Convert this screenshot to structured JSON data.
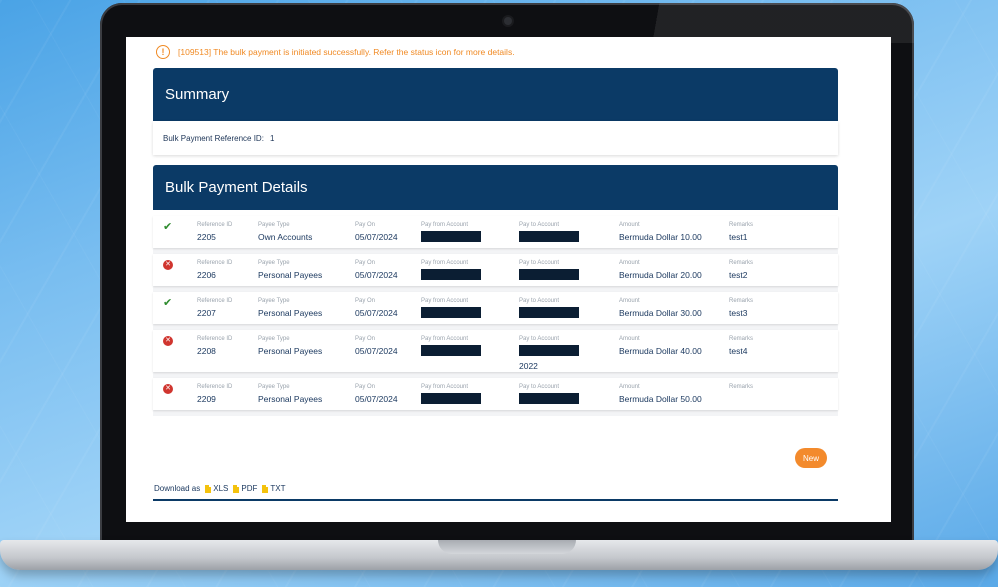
{
  "alert": {
    "icon": "exclamation-icon",
    "text": "[109513] The bulk payment is initiated successfully. Refer the status icon for more details."
  },
  "summary": {
    "title": "Summary",
    "ref_label": "Bulk Payment Reference ID:",
    "ref_value": "1"
  },
  "details": {
    "title": "Bulk Payment Details",
    "columns": {
      "reference_id": "Reference ID",
      "payee_type": "Payee Type",
      "pay_on": "Pay On",
      "pay_from": "Pay from Account",
      "pay_to": "Pay to Account",
      "amount": "Amount",
      "remarks": "Remarks"
    },
    "rows": [
      {
        "status": "success",
        "status_icon": "check-icon",
        "reference_id": "2205",
        "payee_type": "Own Accounts",
        "pay_on": "05/07/2024",
        "pay_to_extra": "",
        "amount": "Bermuda Dollar 10.00",
        "remarks": "test1"
      },
      {
        "status": "error",
        "status_icon": "error-x-icon",
        "reference_id": "2206",
        "payee_type": "Personal Payees",
        "pay_on": "05/07/2024",
        "pay_to_extra": "",
        "amount": "Bermuda Dollar 20.00",
        "remarks": "test2"
      },
      {
        "status": "success",
        "status_icon": "check-icon",
        "reference_id": "2207",
        "payee_type": "Personal Payees",
        "pay_on": "05/07/2024",
        "pay_to_extra": "",
        "amount": "Bermuda Dollar 30.00",
        "remarks": "test3"
      },
      {
        "status": "error",
        "status_icon": "error-x-icon",
        "reference_id": "2208",
        "payee_type": "Personal Payees",
        "pay_on": "05/07/2024",
        "pay_to_extra": "2022",
        "amount": "Bermuda Dollar 40.00",
        "remarks": "test4"
      },
      {
        "status": "error",
        "status_icon": "error-x-icon",
        "reference_id": "2209",
        "payee_type": "Personal Payees",
        "pay_on": "05/07/2024",
        "pay_to_extra": "",
        "amount": "Bermuda Dollar 50.00",
        "remarks": ""
      }
    ]
  },
  "new_button": "New",
  "download": {
    "label": "Download as",
    "formats": [
      "XLS",
      "PDF",
      "TXT"
    ]
  },
  "colors": {
    "header": "#0b3a66",
    "accent": "#f38a2c",
    "success": "#2e8b2e",
    "error": "#d0352f"
  }
}
